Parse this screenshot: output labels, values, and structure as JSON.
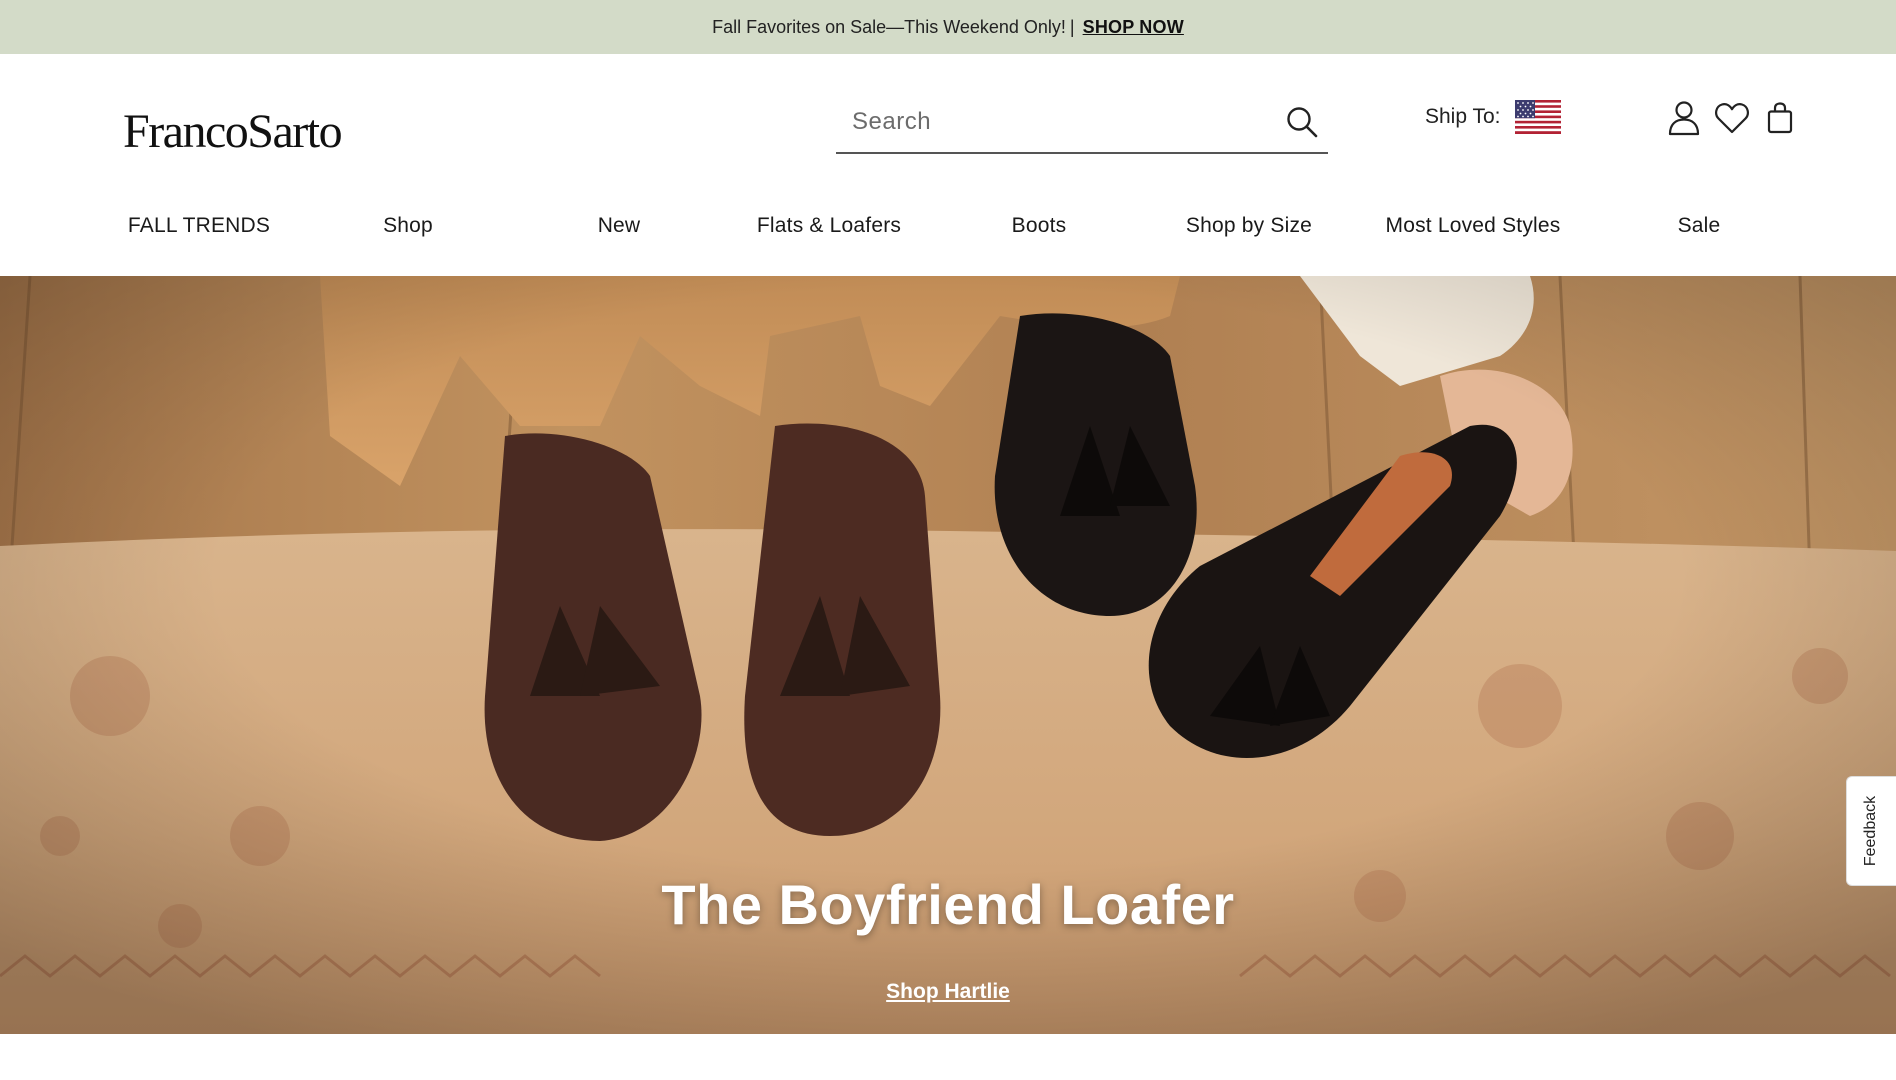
{
  "promo": {
    "text": "Fall Favorites on Sale—This Weekend Only!",
    "separator": "|",
    "cta": "SHOP NOW"
  },
  "header": {
    "logo": "FrancoSarto",
    "search": {
      "placeholder": "Search",
      "icon": "search-icon"
    },
    "ship_to": {
      "label": "Ship To:",
      "country_flag": "us-flag-icon"
    },
    "icons": [
      "account-icon",
      "heart-icon",
      "bag-icon"
    ]
  },
  "nav": {
    "items": [
      {
        "label": "FALL TRENDS"
      },
      {
        "label": "Shop"
      },
      {
        "label": "New"
      },
      {
        "label": "Flats & Loafers"
      },
      {
        "label": "Boots"
      },
      {
        "label": "Shop by Size"
      },
      {
        "label": "Most Loved Styles"
      },
      {
        "label": "Sale"
      }
    ]
  },
  "hero": {
    "title": "The Boyfriend Loafer",
    "link": "Shop Hartlie"
  },
  "feedback": {
    "label": "Feedback"
  },
  "colors": {
    "promo_bg": "#d3dbc8",
    "text": "#1a1a1a",
    "hero_text": "#ffffff"
  }
}
